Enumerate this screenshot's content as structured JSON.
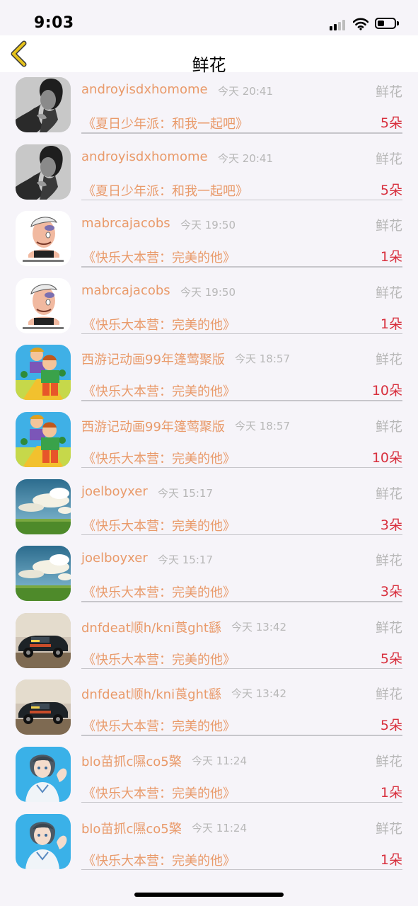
{
  "status": {
    "time": "9:03"
  },
  "nav": {
    "title": "鲜花",
    "back_icon": "chevron-left-icon"
  },
  "items": [
    {
      "name": "androyisdxhomome",
      "time": "今天 20:41",
      "label": "鲜花",
      "show": "《夏日少年派：和我一起吧》",
      "count": "5朵",
      "avatar": "man-portrait"
    },
    {
      "name": "androyisdxhomome",
      "time": "今天 20:41",
      "label": "鲜花",
      "show": "《夏日少年派：和我一起吧》",
      "count": "5朵",
      "avatar": "man-portrait"
    },
    {
      "name": "mabrcajacobs",
      "time": "今天 19:50",
      "label": "鲜花",
      "show": "《快乐大本营：完美的他》",
      "count": "1朵",
      "avatar": "cartoon-guy"
    },
    {
      "name": "mabrcajacobs",
      "time": "今天 19:50",
      "label": "鲜花",
      "show": "《快乐大本营：完美的他》",
      "count": "1朵",
      "avatar": "cartoon-guy"
    },
    {
      "name": "西游记动画99年篷莺聚版",
      "time": "今天 18:57",
      "label": "鲜花",
      "show": "《快乐大本营：完美的他》",
      "count": "10朵",
      "avatar": "cartoon-kids"
    },
    {
      "name": "西游记动画99年篷莺聚版",
      "time": "今天 18:57",
      "label": "鲜花",
      "show": "《快乐大本营：完美的他》",
      "count": "10朵",
      "avatar": "cartoon-kids"
    },
    {
      "name": "joelboyxer",
      "time": "今天 15:17",
      "label": "鲜花",
      "show": "《快乐大本营：完美的他》",
      "count": "3朵",
      "avatar": "sky-field"
    },
    {
      "name": "joelboyxer",
      "time": "今天 15:17",
      "label": "鲜花",
      "show": "《快乐大本营：完美的他》",
      "count": "3朵",
      "avatar": "sky-field"
    },
    {
      "name": "dnfdeat顺h/kni莨ght繇",
      "time": "今天 13:42",
      "label": "鲜花",
      "show": "《快乐大本营：完美的他》",
      "count": "5朵",
      "avatar": "vintage-car"
    },
    {
      "name": "dnfdeat顺h/kni莨ght繇",
      "time": "今天 13:42",
      "label": "鲜花",
      "show": "《快乐大本营：完美的他》",
      "count": "5朵",
      "avatar": "vintage-car"
    },
    {
      "name": "blo苗抓c隰co5檠",
      "time": "今天 11:24",
      "label": "鲜花",
      "show": "《快乐大本营：完美的他》",
      "count": "1朵",
      "avatar": "anime-boy"
    },
    {
      "name": "blo苗抓c隰co5檠",
      "time": "今天 11:24",
      "label": "鲜花",
      "show": "《快乐大本营：完美的他》",
      "count": "1朵",
      "avatar": "anime-boy"
    }
  ],
  "colors": {
    "accent_name": "#e99a6a",
    "count_red": "#d8303e",
    "muted": "#b8b8b8",
    "back_arrow": "#e6c21c"
  }
}
